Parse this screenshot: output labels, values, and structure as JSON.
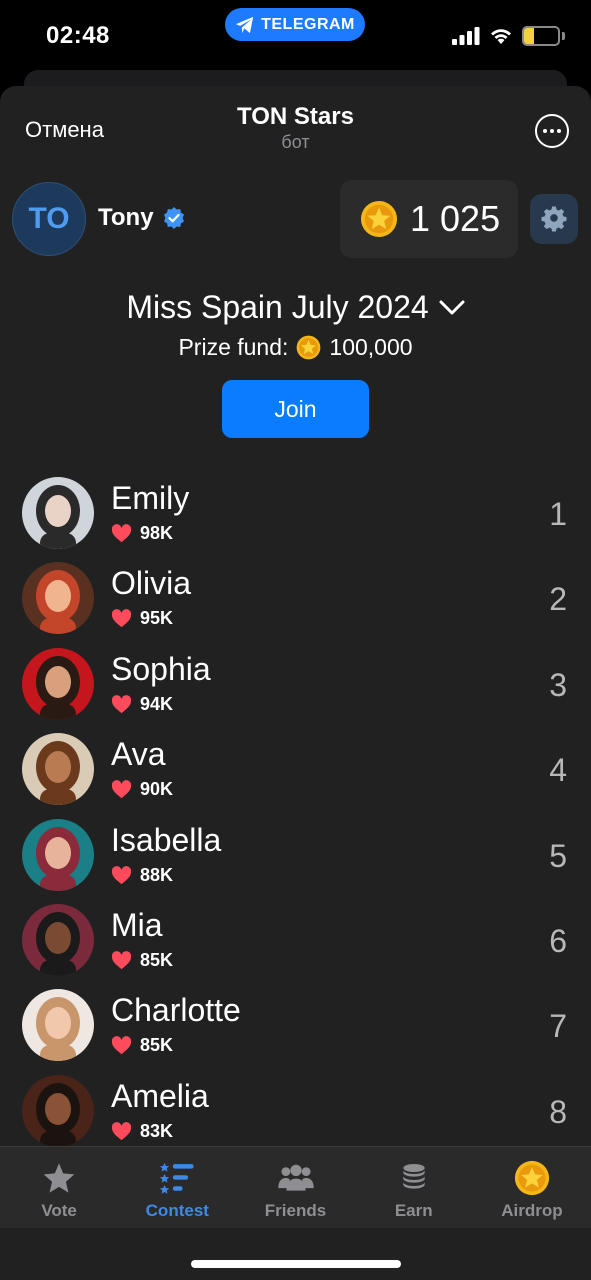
{
  "status_bar": {
    "time": "02:48",
    "telegram_label": "TELEGRAM",
    "battery": "30",
    "battery_level": 0.3
  },
  "header": {
    "cancel_label": "Отмена",
    "title": "TON Stars",
    "subtitle": "бот"
  },
  "profile": {
    "initials": "TO",
    "username": "Tony",
    "balance": "1 025"
  },
  "contest": {
    "title": "Miss Spain July 2024",
    "prize_label": "Prize fund:",
    "prize_value": "100,000",
    "join_label": "Join"
  },
  "colors": {
    "accent": "#0a7cff",
    "coin": "#f5b718",
    "heart": "#ff4b5c",
    "active_tab": "#3d8ae6"
  },
  "contestants": [
    {
      "name": "Emily",
      "likes": "98K",
      "rank": "1"
    },
    {
      "name": "Olivia",
      "likes": "95K",
      "rank": "2"
    },
    {
      "name": "Sophia",
      "likes": "94K",
      "rank": "3"
    },
    {
      "name": "Ava",
      "likes": "90K",
      "rank": "4"
    },
    {
      "name": "Isabella",
      "likes": "88K",
      "rank": "5"
    },
    {
      "name": "Mia",
      "likes": "85K",
      "rank": "6"
    },
    {
      "name": "Charlotte",
      "likes": "85K",
      "rank": "7"
    },
    {
      "name": "Amelia",
      "likes": "83K",
      "rank": "8"
    }
  ],
  "tabs": [
    {
      "label": "Vote",
      "icon": "star-icon",
      "active": false
    },
    {
      "label": "Contest",
      "icon": "ranking-list-icon",
      "active": true
    },
    {
      "label": "Friends",
      "icon": "friends-icon",
      "active": false
    },
    {
      "label": "Earn",
      "icon": "coin-stack-icon",
      "active": false
    },
    {
      "label": "Airdrop",
      "icon": "coin-star-icon",
      "active": false
    }
  ]
}
